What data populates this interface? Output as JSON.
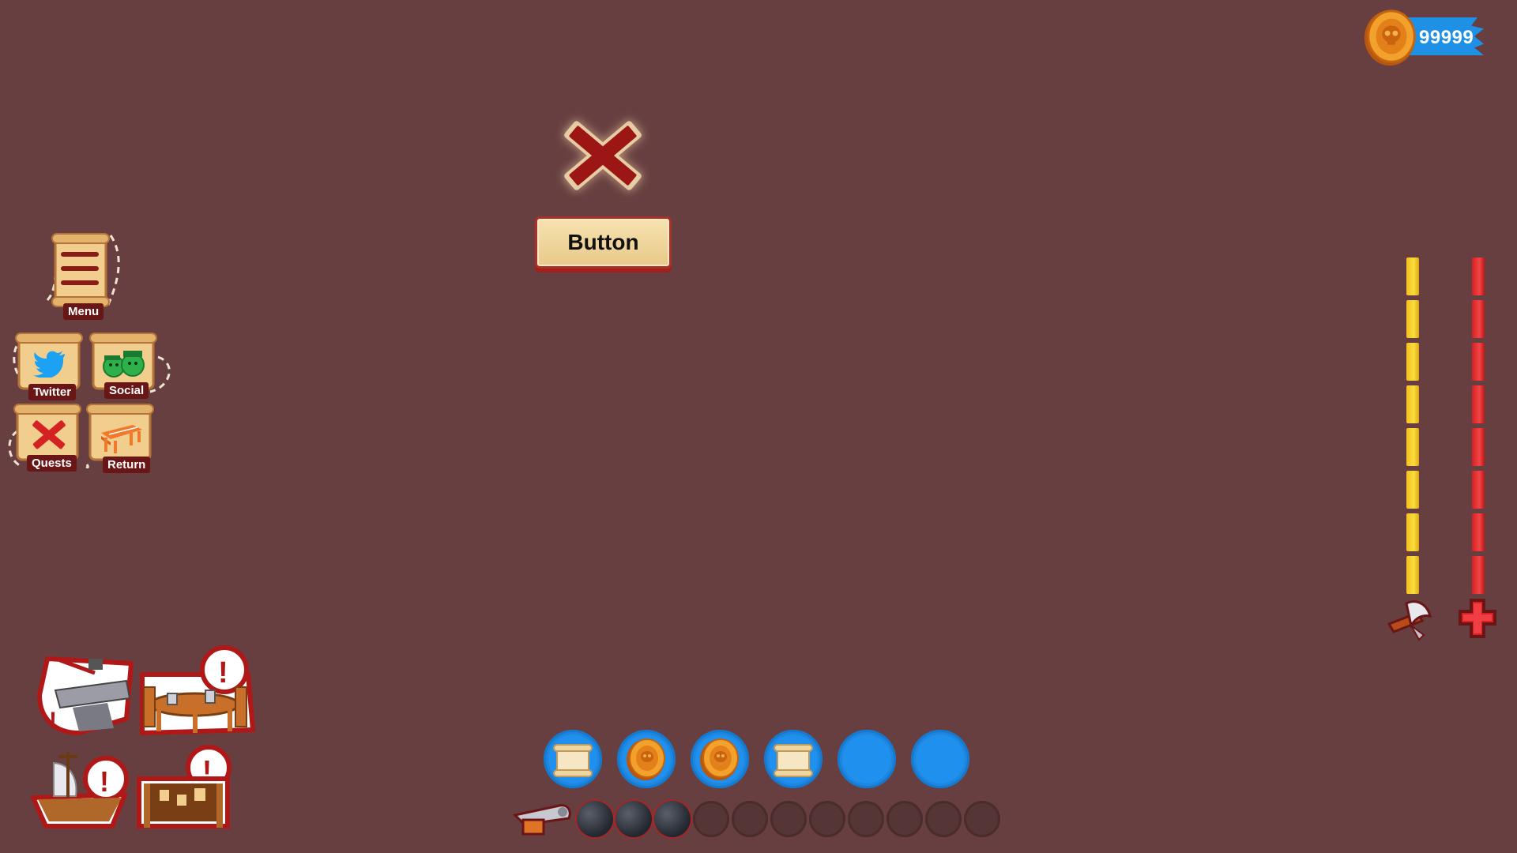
{
  "currency": {
    "amount": "99999",
    "icon": "skull-coin-icon"
  },
  "center_button": {
    "label": "Button",
    "icon": "red-x-icon"
  },
  "menu": {
    "main": {
      "label": "Menu",
      "icon": "bone-scroll-icon"
    },
    "items": [
      {
        "label": "Twitter",
        "icon": "twitter-bird-icon"
      },
      {
        "label": "Social",
        "icon": "pirate-heads-icon"
      },
      {
        "label": "Quests",
        "icon": "red-x-map-icon"
      },
      {
        "label": "Return",
        "icon": "dock-icon"
      }
    ]
  },
  "bars": {
    "yellow": {
      "segments": 8,
      "filled": 8,
      "icon": "axe-icon"
    },
    "red": {
      "segments": 8,
      "filled": 8,
      "icon": "health-cross-icon"
    }
  },
  "inventory": {
    "slots": [
      "scroll-icon",
      "skull-coin-icon",
      "skull-coin-icon",
      "scroll-icon",
      "empty",
      "empty"
    ]
  },
  "ammo": {
    "icon": "cannon-icon",
    "total": 11,
    "loaded": 3
  },
  "buildings": [
    {
      "name": "anvil-building-icon",
      "alert": true
    },
    {
      "name": "tavern-table-icon",
      "alert": true
    },
    {
      "name": "ship-icon",
      "alert": true
    },
    {
      "name": "notice-board-icon",
      "alert": true
    }
  ],
  "colors": {
    "background": "#673f40",
    "currency_banner": "#1e90e6",
    "slot_blue": "#1f86e0",
    "bar_yellow": "#f4c01e",
    "bar_red": "#d81f24",
    "label_bg": "#6a1616"
  }
}
